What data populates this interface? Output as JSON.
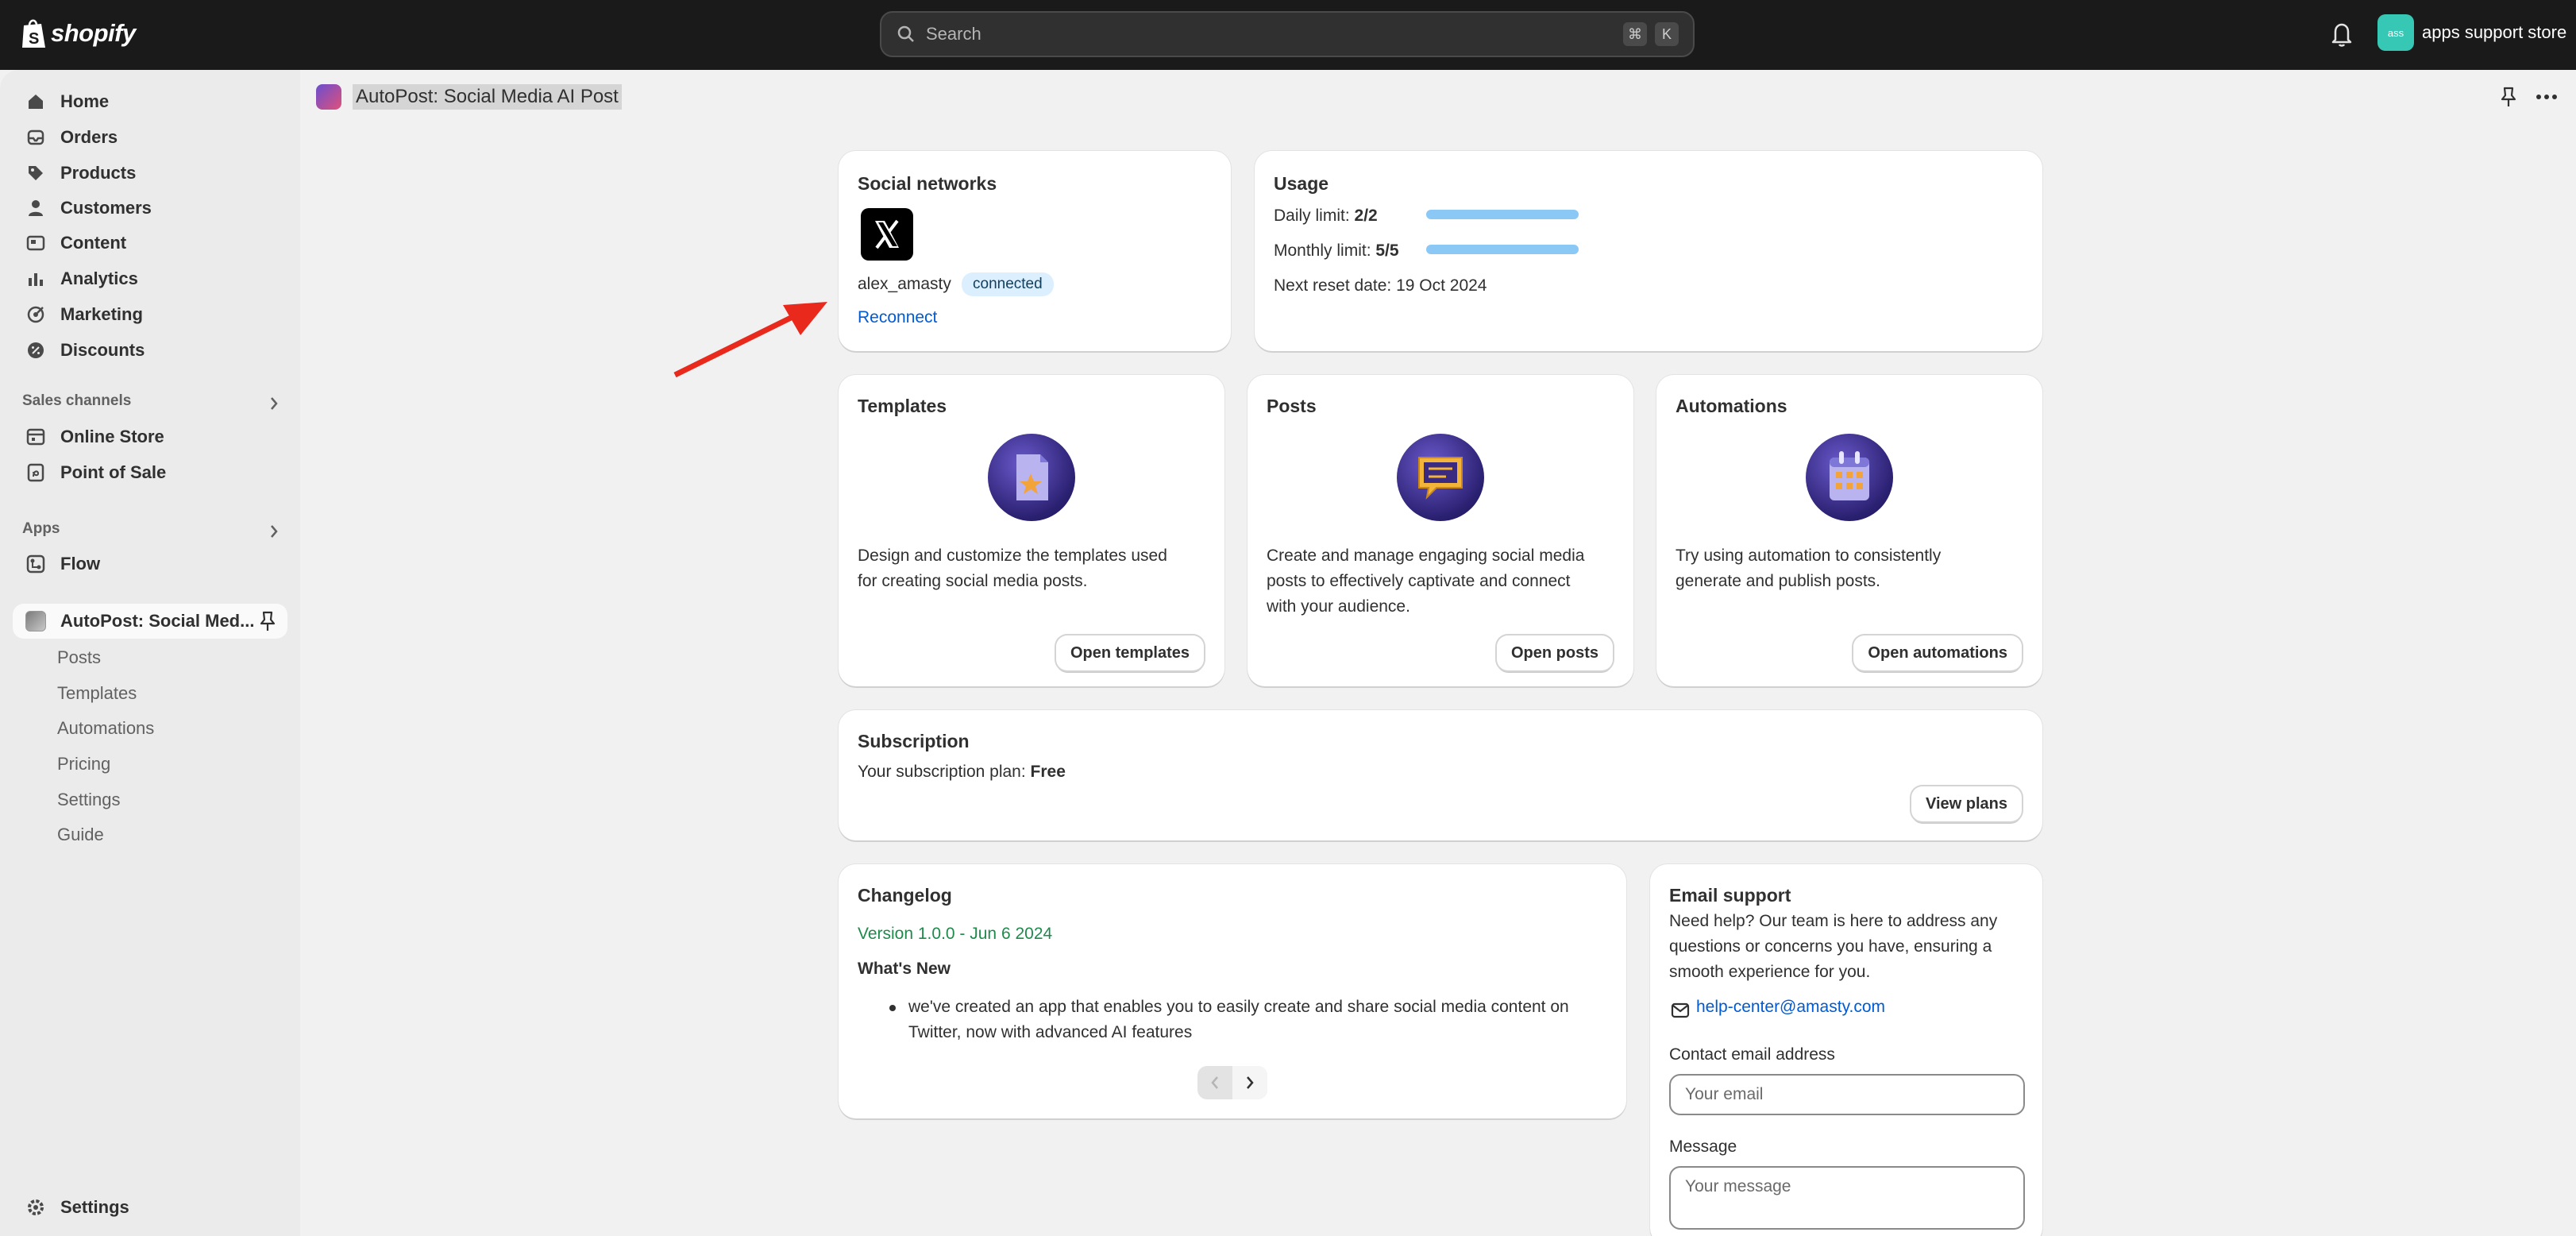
{
  "topbar": {
    "brand": "shopify",
    "search_placeholder": "Search",
    "shortcut_cmd": "⌘",
    "shortcut_key": "K",
    "store_initials": "ass",
    "store_name": "apps support store"
  },
  "sidebar": {
    "items": [
      {
        "label": "Home",
        "icon": "home-icon"
      },
      {
        "label": "Orders",
        "icon": "orders-icon"
      },
      {
        "label": "Products",
        "icon": "tag-icon"
      },
      {
        "label": "Customers",
        "icon": "person-icon"
      },
      {
        "label": "Content",
        "icon": "content-icon"
      },
      {
        "label": "Analytics",
        "icon": "analytics-icon"
      },
      {
        "label": "Marketing",
        "icon": "marketing-icon"
      },
      {
        "label": "Discounts",
        "icon": "discount-icon"
      }
    ],
    "sales_channels_label": "Sales channels",
    "sales_channels": [
      {
        "label": "Online Store",
        "icon": "store-icon"
      },
      {
        "label": "Point of Sale",
        "icon": "pos-icon"
      }
    ],
    "apps_label": "Apps",
    "apps": [
      {
        "label": "Flow",
        "icon": "flow-icon"
      }
    ],
    "active_app": "AutoPost: Social Med...",
    "sub_items": [
      "Posts",
      "Templates",
      "Automations",
      "Pricing",
      "Settings",
      "Guide"
    ],
    "settings_label": "Settings"
  },
  "page": {
    "title": "AutoPost: Social Media AI Post"
  },
  "social": {
    "heading": "Social networks",
    "account": "alex_amasty",
    "status": "connected",
    "reconnect": "Reconnect"
  },
  "usage": {
    "heading": "Usage",
    "daily_label": "Daily limit: ",
    "daily_value": "2/2",
    "daily_fraction": 1.0,
    "monthly_label": "Monthly limit: ",
    "monthly_value": "5/5",
    "monthly_fraction": 1.0,
    "reset": "Next reset date: 19 Oct 2024"
  },
  "templates": {
    "heading": "Templates",
    "desc_1": "Design and customize the templates used",
    "desc_2": "for creating social media posts.",
    "button": "Open templates"
  },
  "posts": {
    "heading": "Posts",
    "desc_1": "Create and manage engaging social media",
    "desc_2": "posts to effectively captivate and connect",
    "desc_3": "with your audience.",
    "button": "Open posts"
  },
  "automations": {
    "heading": "Automations",
    "desc_1": "Try using automation to consistently",
    "desc_2": "generate and publish posts.",
    "button": "Open automations"
  },
  "subscription": {
    "heading": "Subscription",
    "plan_label": "Your subscription plan: ",
    "plan_value": "Free",
    "button": "View plans"
  },
  "changelog": {
    "heading": "Changelog",
    "version": "Version 1.0.0 - Jun 6 2024",
    "subheading": "What's New",
    "bullet_1": "we've created an app that enables you to easily create and share social media content on",
    "bullet_2": "Twitter, now with advanced AI features"
  },
  "support": {
    "heading": "Email support",
    "desc_1": "Need help? Our team is here to address any",
    "desc_2": "questions or concerns you have, ensuring a",
    "desc_3": "smooth experience for you.",
    "email": "help-center@amasty.com",
    "contact_label": "Contact email address",
    "email_placeholder": "Your email",
    "message_label": "Message",
    "message_placeholder": "Your message"
  },
  "colors": {
    "topbar": "#1a1a1a",
    "accent_link": "#005bd3",
    "version_green": "#1f8a4c",
    "usage_bar": "#8cc8f6",
    "arrow": "#e8291c"
  }
}
